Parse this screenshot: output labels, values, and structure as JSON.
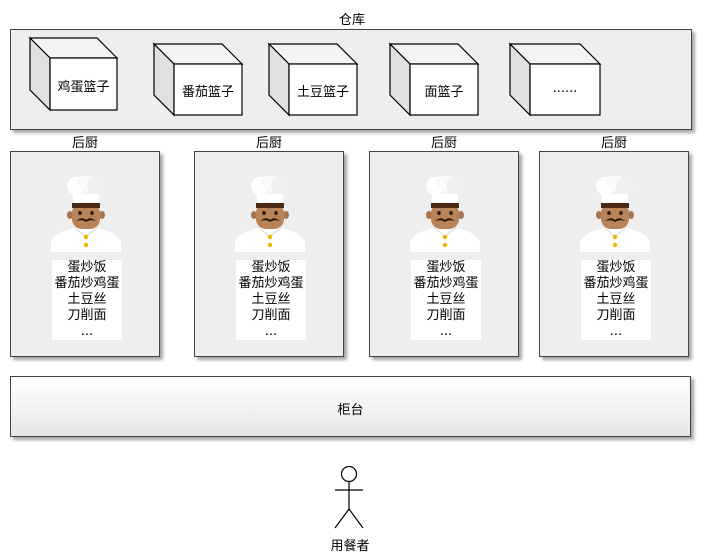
{
  "warehouse": {
    "title": "仓库",
    "baskets": [
      {
        "label": "鸡蛋篮子"
      },
      {
        "label": "番茄篮子"
      },
      {
        "label": "土豆篮子"
      },
      {
        "label": "面篮子"
      },
      {
        "label": "......"
      }
    ]
  },
  "kitchens": [
    {
      "title": "后厨",
      "menu": [
        "蛋炒饭",
        "番茄炒鸡蛋",
        "土豆丝",
        "刀削面",
        "..."
      ]
    },
    {
      "title": "后厨",
      "menu": [
        "蛋炒饭",
        "番茄炒鸡蛋",
        "土豆丝",
        "刀削面",
        "..."
      ]
    },
    {
      "title": "后厨",
      "menu": [
        "蛋炒饭",
        "番茄炒鸡蛋",
        "土豆丝",
        "刀削面",
        "..."
      ]
    },
    {
      "title": "后厨",
      "menu": [
        "蛋炒饭",
        "番茄炒鸡蛋",
        "土豆丝",
        "刀削面",
        "..."
      ]
    }
  ],
  "counter": {
    "label": "柜台"
  },
  "diner": {
    "label": "用餐者"
  }
}
